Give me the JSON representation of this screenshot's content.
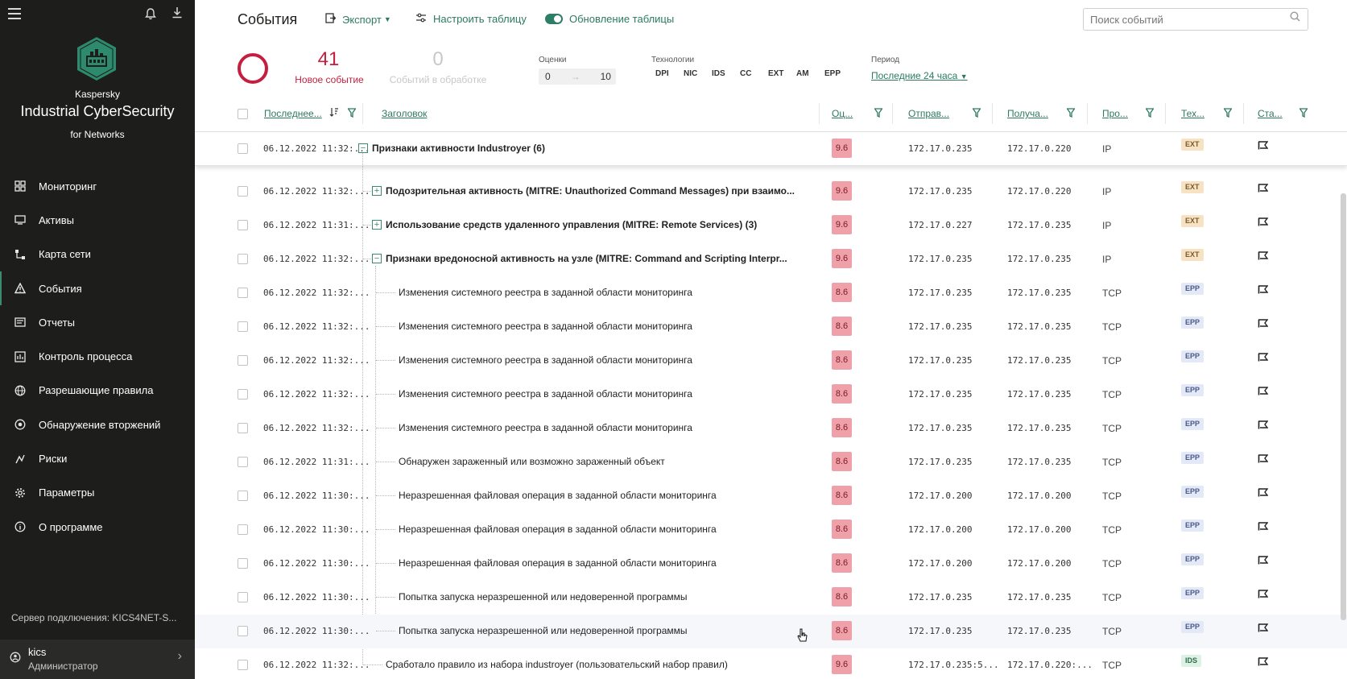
{
  "sidebar": {
    "brand_line1": "Kaspersky",
    "brand_line2": "Industrial CyberSecurity",
    "brand_line3": "for Networks",
    "nav": [
      {
        "label": "Мониторинг",
        "icon": "dashboard-icon"
      },
      {
        "label": "Активы",
        "icon": "assets-icon"
      },
      {
        "label": "Карта сети",
        "icon": "network-map-icon"
      },
      {
        "label": "События",
        "icon": "warning-icon",
        "active": true
      },
      {
        "label": "Отчеты",
        "icon": "reports-icon"
      },
      {
        "label": "Контроль процесса",
        "icon": "process-control-icon"
      },
      {
        "label": "Разрешающие правила",
        "icon": "globe-icon"
      },
      {
        "label": "Обнаружение вторжений",
        "icon": "intrusion-icon"
      },
      {
        "label": "Риски",
        "icon": "risks-icon"
      },
      {
        "label": "Параметры",
        "icon": "gear-icon"
      },
      {
        "label": "О программе",
        "icon": "info-icon"
      }
    ],
    "server_label": "Сервер подключения:",
    "server_value": "KICS4NET-S...",
    "user_name": "kics",
    "user_role": "Администратор"
  },
  "header": {
    "title": "События",
    "export_label": "Экспорт",
    "configure_label": "Настроить таблицу",
    "refresh_label": "Обновление таблицы",
    "search_placeholder": "Поиск событий"
  },
  "stats": {
    "new_count": "41",
    "new_label": "Новое событие",
    "processing_count": "0",
    "processing_label": "Событий в обработке",
    "scores_label": "Оценки",
    "score_min": "0",
    "score_max": "10",
    "tech_label": "Технологии",
    "technologies": [
      "DPI",
      "NIC",
      "IDS",
      "CC",
      "EXT",
      "AM",
      "EPP"
    ],
    "period_label": "Период",
    "period_value": "Последние 24 часа"
  },
  "table": {
    "columns": {
      "last": "Последнее...",
      "title": "Заголовок",
      "score": "Оц...",
      "sender": "Отправ...",
      "receiver": "Получа...",
      "proto": "Про...",
      "tech": "Тех...",
      "status": "Ста..."
    },
    "rows": [
      {
        "date": "06.12.2022 11:32:...",
        "title": "Признаки активности Industroyer (6)",
        "level": 0,
        "expander": "minus",
        "bold": true,
        "score": "9.6",
        "sender": "172.17.0.235",
        "receiver": "172.17.0.220",
        "proto": "IP",
        "tech": "EXT"
      },
      {
        "date": "06.12.2022 11:32:...",
        "title": "Подозрительная активность (MITRE: Unauthorized Command Messages) при взаимо...",
        "level": 1,
        "expander": "plus",
        "bold": true,
        "score": "9.6",
        "sender": "172.17.0.235",
        "receiver": "172.17.0.220",
        "proto": "IP",
        "tech": "EXT"
      },
      {
        "date": "06.12.2022 11:31:...",
        "title": "Использование средств удаленного управления (MITRE: Remote Services) (3)",
        "level": 1,
        "expander": "plus",
        "bold": true,
        "score": "9.6",
        "sender": "172.17.0.227",
        "receiver": "172.17.0.235",
        "proto": "IP",
        "tech": "EXT"
      },
      {
        "date": "06.12.2022 11:32:...",
        "title": "Признаки вредоносной активность на узле (MITRE: Command and Scripting Interpr...",
        "level": 1,
        "expander": "minus",
        "bold": true,
        "score": "9.6",
        "sender": "172.17.0.235",
        "receiver": "172.17.0.235",
        "proto": "IP",
        "tech": "EXT"
      },
      {
        "date": "06.12.2022 11:32:...",
        "title": "Изменения системного реестра в заданной области мониторинга",
        "level": 2,
        "score": "8.6",
        "sender": "172.17.0.235",
        "receiver": "172.17.0.235",
        "proto": "TCP",
        "tech": "EPP"
      },
      {
        "date": "06.12.2022 11:32:...",
        "title": "Изменения системного реестра в заданной области мониторинга",
        "level": 2,
        "score": "8.6",
        "sender": "172.17.0.235",
        "receiver": "172.17.0.235",
        "proto": "TCP",
        "tech": "EPP"
      },
      {
        "date": "06.12.2022 11:32:...",
        "title": "Изменения системного реестра в заданной области мониторинга",
        "level": 2,
        "score": "8.6",
        "sender": "172.17.0.235",
        "receiver": "172.17.0.235",
        "proto": "TCP",
        "tech": "EPP"
      },
      {
        "date": "06.12.2022 11:32:...",
        "title": "Изменения системного реестра в заданной области мониторинга",
        "level": 2,
        "score": "8.6",
        "sender": "172.17.0.235",
        "receiver": "172.17.0.235",
        "proto": "TCP",
        "tech": "EPP"
      },
      {
        "date": "06.12.2022 11:32:...",
        "title": "Изменения системного реестра в заданной области мониторинга",
        "level": 2,
        "score": "8.6",
        "sender": "172.17.0.235",
        "receiver": "172.17.0.235",
        "proto": "TCP",
        "tech": "EPP"
      },
      {
        "date": "06.12.2022 11:31:...",
        "title": "Обнаружен зараженный или возможно зараженный объект",
        "level": 2,
        "score": "8.6",
        "sender": "172.17.0.235",
        "receiver": "172.17.0.235",
        "proto": "TCP",
        "tech": "EPP"
      },
      {
        "date": "06.12.2022 11:30:...",
        "title": "Неразрешенная файловая операция в заданной области мониторинга",
        "level": 2,
        "score": "8.6",
        "sender": "172.17.0.200",
        "receiver": "172.17.0.200",
        "proto": "TCP",
        "tech": "EPP"
      },
      {
        "date": "06.12.2022 11:30:...",
        "title": "Неразрешенная файловая операция в заданной области мониторинга",
        "level": 2,
        "score": "8.6",
        "sender": "172.17.0.200",
        "receiver": "172.17.0.200",
        "proto": "TCP",
        "tech": "EPP"
      },
      {
        "date": "06.12.2022 11:30:...",
        "title": "Неразрешенная файловая операция в заданной области мониторинга",
        "level": 2,
        "score": "8.6",
        "sender": "172.17.0.200",
        "receiver": "172.17.0.200",
        "proto": "TCP",
        "tech": "EPP"
      },
      {
        "date": "06.12.2022 11:30:...",
        "title": "Попытка запуска неразрешенной или недоверенной программы",
        "level": 2,
        "score": "8.6",
        "sender": "172.17.0.235",
        "receiver": "172.17.0.235",
        "proto": "TCP",
        "tech": "EPP"
      },
      {
        "date": "06.12.2022 11:30:...",
        "title": "Попытка запуска неразрешенной или недоверенной программы",
        "level": 2,
        "score": "8.6",
        "sender": "172.17.0.235",
        "receiver": "172.17.0.235",
        "proto": "TCP",
        "tech": "EPP",
        "hover": true
      },
      {
        "date": "06.12.2022 11:32:...",
        "title": "Сработало правило из набора industroyer (пользовательский набор правил)",
        "level": 1,
        "score": "9.6",
        "sender": "172.17.0.235:5...",
        "receiver": "172.17.0.220:...",
        "proto": "TCP",
        "tech": "IDS"
      }
    ]
  },
  "colors": {
    "accent": "#2c7a62",
    "alert": "#c41f3e",
    "score_bg": "#f0a0a8",
    "sidebar_bg": "#1d1d1b"
  }
}
